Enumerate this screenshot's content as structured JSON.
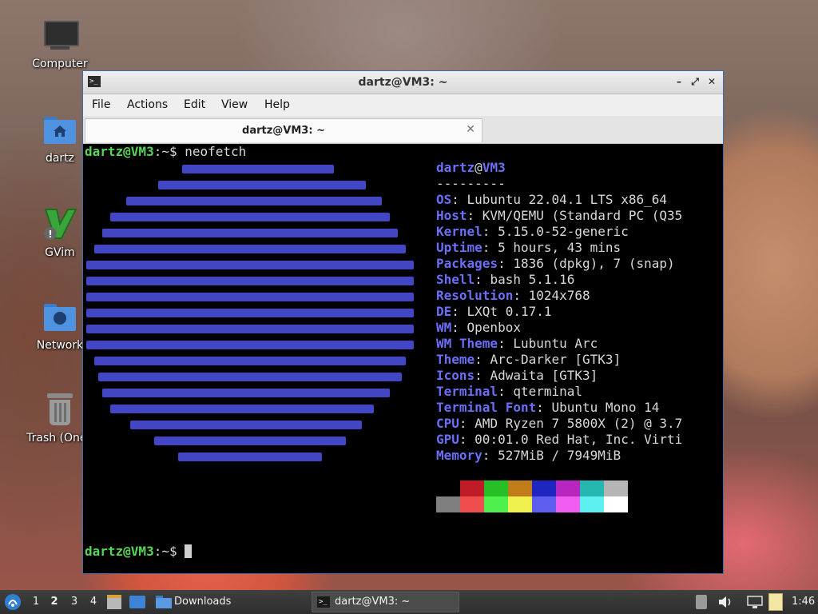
{
  "desktop": {
    "icons": [
      {
        "label": "Computer",
        "icon": "computer-icon"
      },
      {
        "label": "dartz",
        "icon": "home-folder-icon"
      },
      {
        "label": "GVim",
        "icon": "gvim-icon"
      },
      {
        "label": "Network",
        "icon": "network-folder-icon"
      },
      {
        "label": "Trash (One i",
        "icon": "trash-icon"
      }
    ]
  },
  "window": {
    "title": "dartz@VM3: ~",
    "menu": [
      "File",
      "Actions",
      "Edit",
      "View",
      "Help"
    ],
    "tab_title": "dartz@VM3: ~",
    "tab_close": "✕",
    "controls": {
      "minimize": "–",
      "maximize": "⤢",
      "close": "✕"
    }
  },
  "terminal": {
    "prompt_user": "dartz@VM3",
    "prompt_path": ":~$ ",
    "command": "neofetch",
    "header_user": "dartz",
    "header_at": "@",
    "header_host": "VM3",
    "separator": "---------",
    "info": [
      {
        "key": "OS",
        "value": "Lubuntu 22.04.1 LTS x86_64"
      },
      {
        "key": "Host",
        "value": "KVM/QEMU (Standard PC (Q35"
      },
      {
        "key": "Kernel",
        "value": "5.15.0-52-generic"
      },
      {
        "key": "Uptime",
        "value": "5 hours, 43 mins"
      },
      {
        "key": "Packages",
        "value": "1836 (dpkg), 7 (snap)"
      },
      {
        "key": "Shell",
        "value": "bash 5.1.16"
      },
      {
        "key": "Resolution",
        "value": "1024x768"
      },
      {
        "key": "DE",
        "value": "LXQt 0.17.1"
      },
      {
        "key": "WM",
        "value": "Openbox"
      },
      {
        "key": "WM Theme",
        "value": "Lubuntu Arc"
      },
      {
        "key": "Theme",
        "value": "Arc-Darker [GTK3]"
      },
      {
        "key": "Icons",
        "value": "Adwaita [GTK3]"
      },
      {
        "key": "Terminal",
        "value": "qterminal"
      },
      {
        "key": "Terminal Font",
        "value": "Ubuntu Mono 14"
      },
      {
        "key": "CPU",
        "value": "AMD Ryzen 7 5800X (2) @ 3.7"
      },
      {
        "key": "GPU",
        "value": "00:01.0 Red Hat, Inc. Virti"
      },
      {
        "key": "Memory",
        "value": "527MiB / 7949MiB"
      }
    ],
    "palette_top": [
      "#000000",
      "#c01c28",
      "#26c026",
      "#c07d1a",
      "#1f26c0",
      "#b826c0",
      "#26b8b0",
      "#b5b5b5"
    ],
    "palette_bottom": [
      "#7f7f7f",
      "#f04e4e",
      "#4ef04e",
      "#f0f04e",
      "#5d5df0",
      "#f05df0",
      "#5df0f0",
      "#ffffff"
    ],
    "ascii_color": "#4f52e6"
  },
  "taskbar": {
    "desktops": [
      "1",
      "2",
      "3",
      "4"
    ],
    "active_desktop": "2",
    "folder_label": "Downloads",
    "task_label": "dartz@VM3: ~",
    "clock": "1:46",
    "tray_icons": [
      "eject-icon",
      "volume-icon",
      "network-icon",
      "clipboard-icon"
    ]
  }
}
